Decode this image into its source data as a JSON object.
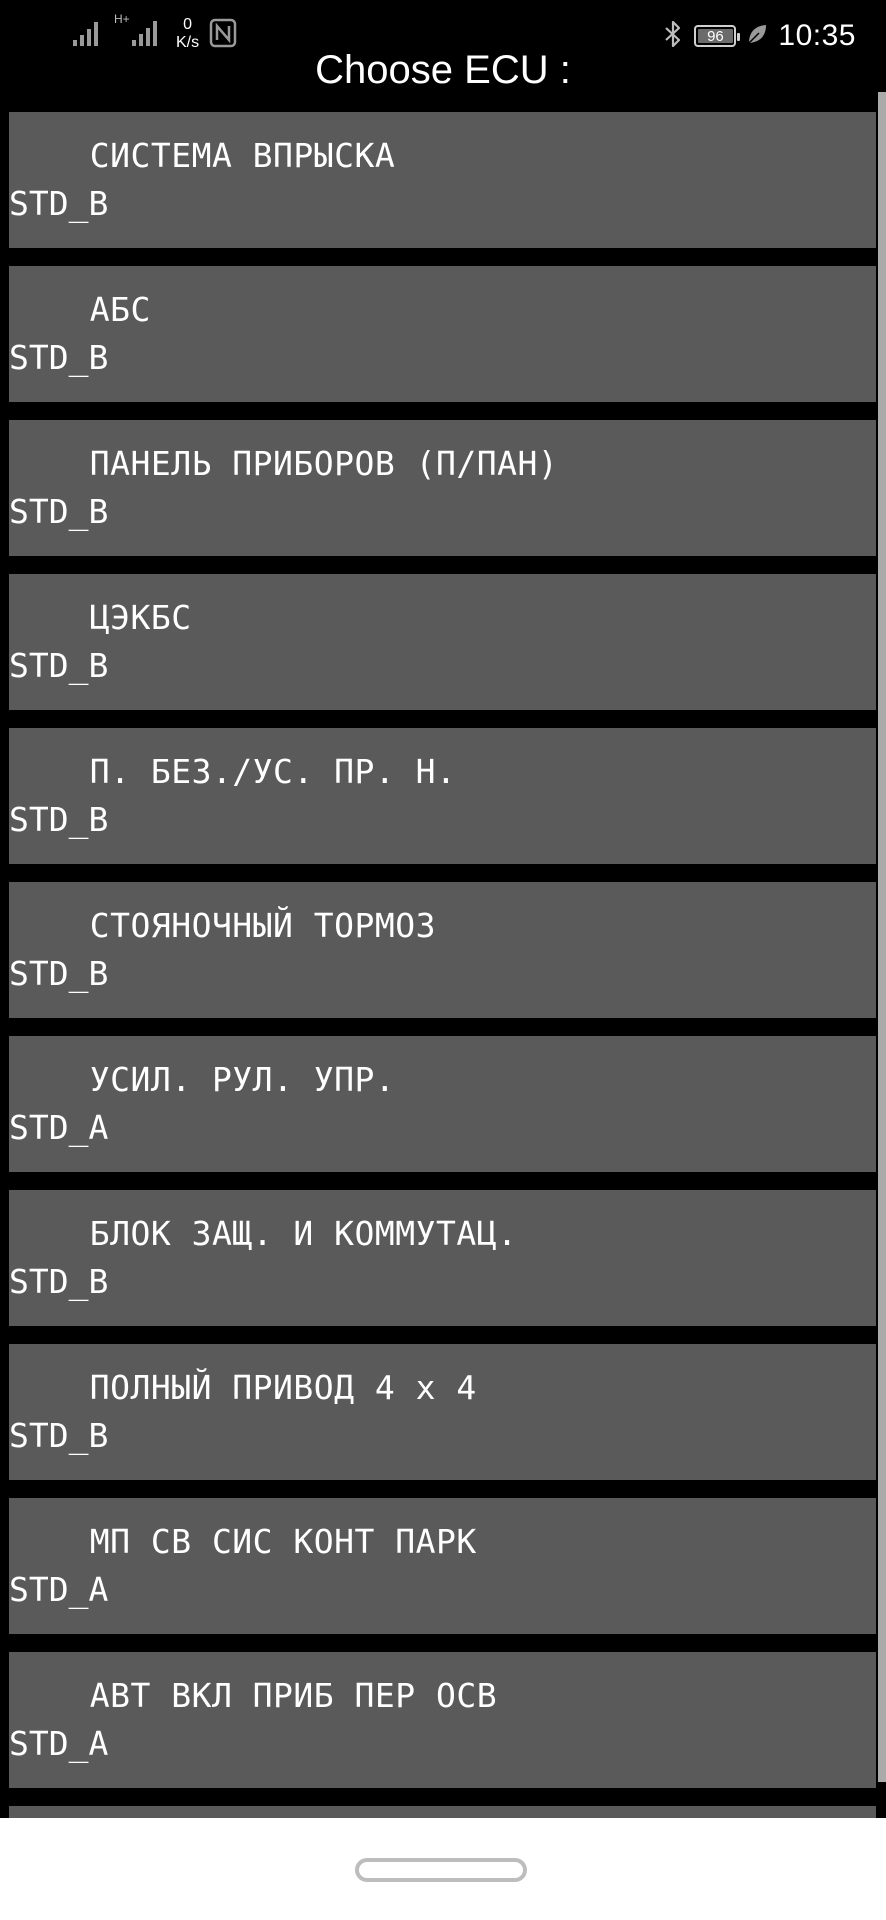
{
  "status_bar": {
    "net_speed_value": "0",
    "net_speed_unit": "K/s",
    "network_type": "H+",
    "battery_level": "96",
    "time": "10:35"
  },
  "header": {
    "title": "Choose ECU :"
  },
  "ecu_list": [
    {
      "name": "  СИСТЕМА ВПРЫСКА",
      "protocol": "STD_B"
    },
    {
      "name": "  АБС",
      "protocol": "STD_B"
    },
    {
      "name": "  ПАНЕЛЬ ПРИБОРОВ (П/ПАН)",
      "protocol": "STD_B"
    },
    {
      "name": "  ЦЭКБС",
      "protocol": "STD_B"
    },
    {
      "name": "  П. БЕЗ./УС. ПР. Н.",
      "protocol": "STD_B"
    },
    {
      "name": "  СТОЯНОЧНЫЙ ТОРМОЗ",
      "protocol": "STD_B"
    },
    {
      "name": "  УСИЛ. РУЛ. УПР.",
      "protocol": "STD_A"
    },
    {
      "name": "  БЛОК ЗАЩ. И КОММУТАЦ.",
      "protocol": "STD_B"
    },
    {
      "name": "  ПОЛНЫЙ ПРИВОД 4 x 4",
      "protocol": "STD_B"
    },
    {
      "name": "  МП СВ СИС КОНТ ПАРК",
      "protocol": "STD_A"
    },
    {
      "name": "  АВТ ВКЛ ПРИБ ПЕР ОСВ",
      "protocol": "STD_A"
    }
  ],
  "colors": {
    "background": "#000000",
    "item_background": "#5a5a5a",
    "text": "#ffffff",
    "nav_bar": "#ffffff"
  }
}
